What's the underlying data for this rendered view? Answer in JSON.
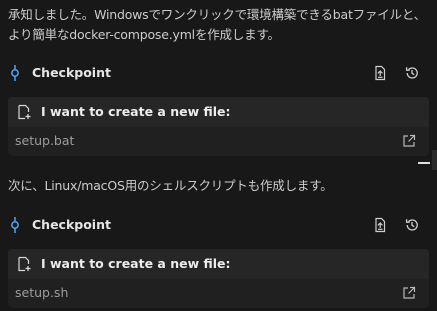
{
  "messages": [
    "承知しました。Windowsでワンクリックで環境構築できるbatファイルと、より簡単なdocker-compose.ymlを作成します。",
    "次に、Linux/macOS用のシェルスクリプトも作成します。"
  ],
  "checkpoints": [
    {
      "label": "Checkpoint",
      "icon": "checkpoint-marker-icon"
    },
    {
      "label": "Checkpoint",
      "icon": "checkpoint-marker-icon"
    }
  ],
  "file_cards": [
    {
      "title": "I want to create a new file:",
      "filename": "setup.bat"
    },
    {
      "title": "I want to create a new file:",
      "filename": "setup.sh"
    }
  ],
  "colors": {
    "background": "#181818",
    "card": "#202020",
    "accent": "#4aa8ff"
  }
}
